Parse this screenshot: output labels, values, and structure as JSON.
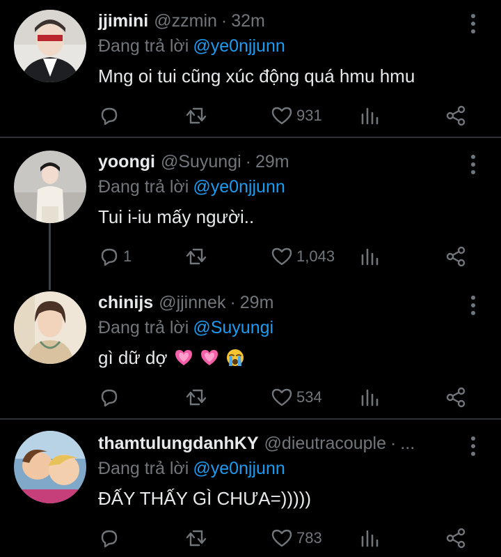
{
  "reply_prefix": "Đang trả lời",
  "colors": {
    "background": "#000000",
    "text": "#e7e9ea",
    "muted": "#71767b",
    "accent": "#1d9bf0",
    "divider": "#2f3336"
  },
  "tweets": [
    {
      "name": "jjimini",
      "handle": "@zzmin",
      "sep": "·",
      "time": "32m",
      "reply_to": "@ye0njjunn",
      "text": "Mng oi tui cũng xúc động quá hmu hmu",
      "reply_count": "",
      "like_count": "931"
    },
    {
      "name": "yoongi",
      "handle": "@Suyungi",
      "sep": "·",
      "time": "29m",
      "reply_to": "@ye0njjunn",
      "text": "Tui i-iu mấy người..",
      "reply_count": "1",
      "like_count": "1,043"
    },
    {
      "name": "chinijs",
      "handle": "@jjinnek",
      "sep": "·",
      "time": "29m",
      "reply_to": "@Suyungi",
      "text": "gì dữ dợ",
      "emojis": [
        "pink-heart-emoji",
        "pink-heart-emoji",
        "crying-face-emoji"
      ],
      "reply_count": "",
      "like_count": "534"
    },
    {
      "name": "thamtulungdanhKY",
      "handle": "@dieutracouple",
      "sep": "·",
      "time": "...",
      "reply_to": "@ye0njjunn",
      "text": "ĐẤY THẤY GÌ CHƯA=)))))",
      "reply_count": "",
      "like_count": "783"
    }
  ],
  "icons": [
    "reply-icon",
    "retweet-icon",
    "like-icon",
    "stats-icon",
    "share-icon",
    "more-options-icon"
  ]
}
